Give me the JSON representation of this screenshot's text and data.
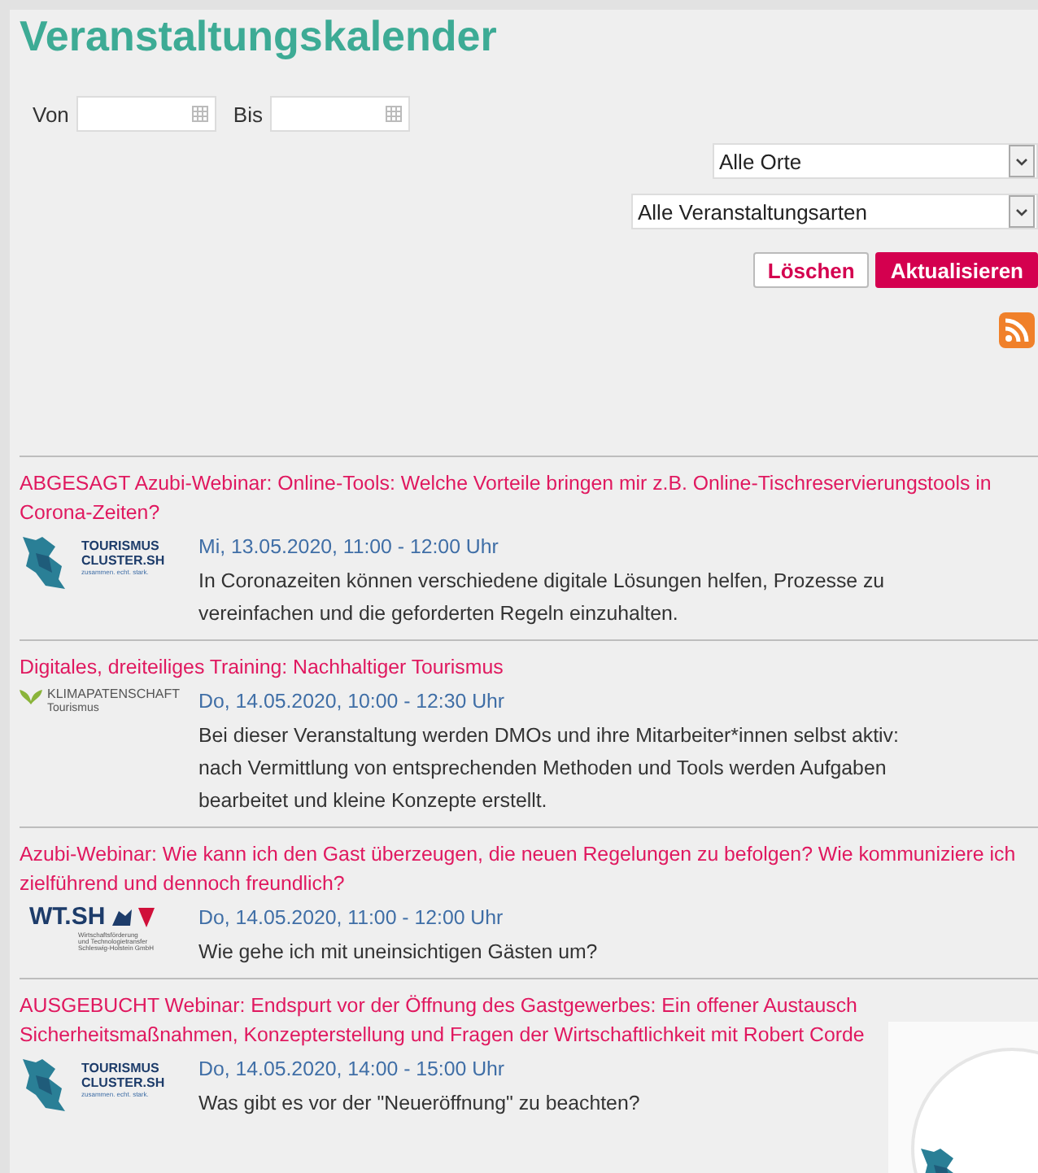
{
  "heading": "Veranstaltungskalender",
  "filters": {
    "from_label": "Von",
    "to_label": "Bis",
    "place_select": "Alle Orte",
    "type_select": "Alle Veranstaltungsarten",
    "buttons": [
      {
        "label": "Löschen",
        "kind": "secondary"
      },
      {
        "label": "Aktualisieren",
        "kind": "primary"
      }
    ]
  },
  "events": [
    {
      "title_lines": [
        "ABGESAGT Azubi-Webinar: Online-Tools: Welche Vorteile bringen mir z.B. Online-Tischreservierungstools in",
        "Corona-Zeiten?"
      ],
      "logo": {
        "kind": "cluster",
        "lines": [
          "TOURISMUS",
          "CLUSTER.SH",
          "zusammen. echt. stark."
        ]
      },
      "date": "Mi, 13.05.2020, 11:00 - 12:00 Uhr",
      "description": "In Coronazeiten können verschiedene digitale Lösungen helfen, Prozesse zu vereinfachen und die geforderten Regeln einzuhalten."
    },
    {
      "title_lines": [
        "Digitales, dreiteiliges Training: Nachhaltiger Tourismus"
      ],
      "logo": {
        "kind": "klima",
        "lines": [
          "KLIMAPATENSCHAFT",
          "Tourismus"
        ]
      },
      "date": "Do, 14.05.2020, 10:00 - 12:30 Uhr",
      "description": "Bei dieser Veranstaltung werden DMOs und ihre Mitarbeiter*innen selbst aktiv: nach Vermittlung von entsprechenden Methoden und Tools werden Aufgaben bearbeitet und kleine Konzepte erstellt."
    },
    {
      "title_lines": [
        "Azubi-Webinar: Wie kann ich den Gast überzeugen, die neuen Regelungen zu befolgen? Wie kommuniziere ich",
        "zielführend und dennoch freundlich?"
      ],
      "logo": {
        "kind": "wtsh",
        "lines": [
          "WT.SH",
          "Wirtschaftsförderung",
          "und Technologietransfer",
          "Schleswig-Holstein GmbH"
        ]
      },
      "date": "Do, 14.05.2020, 11:00 - 12:00 Uhr",
      "description": "Wie gehe ich mit uneinsichtigen Gästen um?"
    },
    {
      "title_lines": [
        "AUSGEBUCHT Webinar: Endspurt vor der Öffnung des Gastgewerbes: Ein offener Austausch",
        "Sicherheitsmaßnahmen, Konzepterstellung und Fragen der Wirtschaftlichkeit mit Robert Corde"
      ],
      "logo": {
        "kind": "cluster",
        "lines": [
          "TOURISMUS",
          "CLUSTER.SH",
          "zusammen. echt. stark."
        ]
      },
      "date": "Do, 14.05.2020, 14:00 - 15:00 Uhr",
      "description": "Was gibt es vor der \"Neueröffnung\" zu beachten?"
    }
  ]
}
